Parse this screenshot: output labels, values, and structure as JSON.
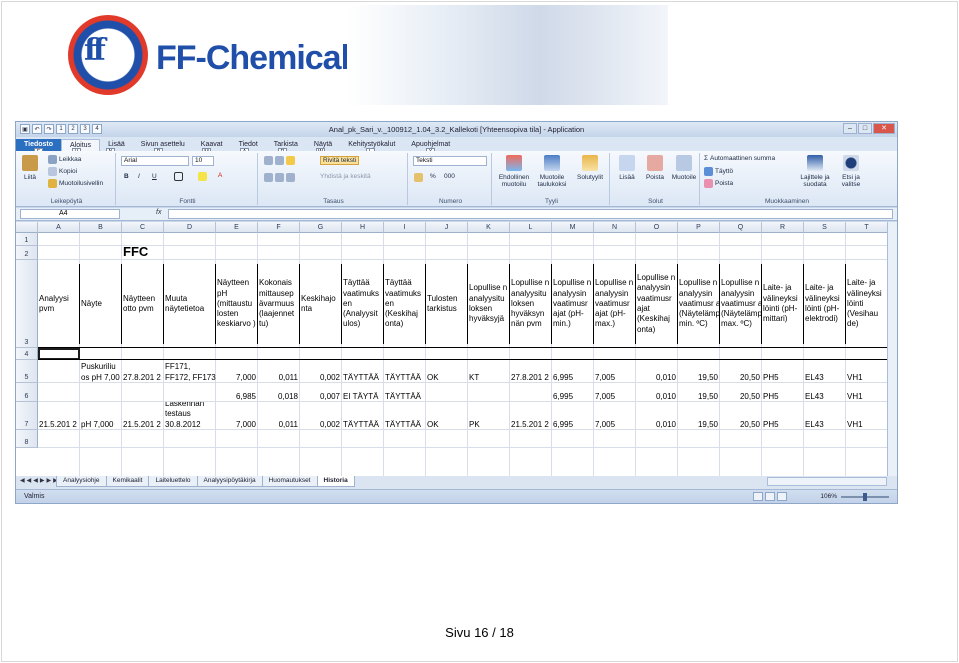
{
  "brand": {
    "logo_name": "FF-Chemicals"
  },
  "window": {
    "title": "Anal_pk_Sari_v._100912_1.04_3.2_Kallekoti [Yhteensopiva tila] - Application",
    "qat_keytips": [
      "1",
      "2",
      "3",
      "4"
    ]
  },
  "tabs": [
    "Tiedosto",
    "Aloitus",
    "Lisää",
    "Sivun asettelu",
    "Kaavat",
    "Tiedot",
    "Tarkista",
    "Näytä",
    "Kehitystyökalut",
    "Apuohjelmat"
  ],
  "keytips": [
    "F",
    "H",
    "N",
    "P",
    "M",
    "A",
    "R",
    "W",
    "L",
    "X"
  ],
  "ribbon": {
    "clipboard": {
      "label": "Leikepöytä",
      "paste": "Liitä",
      "cut": "Leikkaa",
      "copy": "Kopioi",
      "format_painter": "Muotoilusivellin"
    },
    "font": {
      "label": "Fontti",
      "font_name": "Arial",
      "font_size": "10",
      "bold": "B",
      "italic": "I",
      "underline": "U"
    },
    "alignment": {
      "label": "Tasaus",
      "wrap": "Rivitä teksti",
      "merge": "Yhdistä ja keskitä"
    },
    "number": {
      "label": "Numero",
      "format": "Teksti",
      "percent": "%",
      "thousands": "000"
    },
    "styles": {
      "label": "Tyyli",
      "conditional": "Ehdollinen muotoilu",
      "table": "Muotoile taulukoksi",
      "cell": "Solutyylit"
    },
    "cells": {
      "label": "Solut",
      "insert": "Lisää",
      "delete": "Poista",
      "format": "Muotoile"
    },
    "editing": {
      "label": "Muokkaaminen",
      "autosum": "Automaattinen summa",
      "fill": "Täyttö",
      "clear": "Poista",
      "sort": "Lajittele ja suodata",
      "find": "Etsi ja valitse"
    }
  },
  "formula_bar": {
    "name_box": "A4",
    "fx": "fx",
    "value": ""
  },
  "columns": [
    "A",
    "B",
    "C",
    "D",
    "E",
    "F",
    "G",
    "H",
    "I",
    "J",
    "K",
    "L",
    "M",
    "N",
    "O",
    "P",
    "Q",
    "R",
    "S",
    "T"
  ],
  "rows": [
    "1",
    "2",
    "3",
    "4",
    "5",
    "6",
    "7",
    "8"
  ],
  "sheet": {
    "title": "FFC",
    "headers": [
      "Analyysi pvm",
      "Näyte",
      "Näytteen otto pvm",
      "Muuta näytetietoa",
      "Näytteen pH (mittaustu losten keskiarvo )",
      "Kokonais mittausep ävarmuus (laajennet tu)",
      "Keskihajo nta",
      "Täyttää vaatimuks en (Analyysit ulos)",
      "Täyttää vaatimuks en (Keskihaj onta)",
      "Tulosten tarkistus",
      "Lopullise n analyysitu loksen hyväksyjä",
      "Lopullise n analyysitu loksen hyväksyn nän pvm",
      "Lopullise n analyysin vaatimusr ajat (pH-min.)",
      "Lopullise n analyysin vaatimusr ajat (pH-max.)",
      "Lopullise n analyysin vaatimusr ajat (Keskihaj onta)",
      "Lopullise n analyysin vaatimusr ajat (Näytelämpötila min. ºC)",
      "Lopullise n analyysin vaatimusr ajat (Näytelämpötila max. ºC)",
      "Laite- ja välineyksi löinti (pH-mittari)",
      "Laite- ja välineyksi löinti (pH-elektrodi)",
      "Laite- ja välineyksi löinti (Vesihau de)",
      "La va lö (L tä"
    ],
    "data_rows": [
      {
        "A": "",
        "B": "Puskuriliu os pH 7,00",
        "C": "27.8.201 2",
        "D": "FF171, FF172, FF173",
        "E": "7,000",
        "F": "0,011",
        "G": "0,002",
        "H": "TÄYTTÄÄ",
        "I": "TÄYTTÄÄ",
        "J": "OK",
        "K": "KT",
        "L": "27.8.201 2",
        "M": "6,995",
        "N": "7,005",
        "O": "0,010",
        "P": "19,50",
        "Q": "20,50",
        "R": "PH5",
        "S": "EL43",
        "T": "VH1",
        "U": "LI C"
      },
      {
        "A": "",
        "B": "",
        "C": "",
        "D": "",
        "E": "6,985",
        "F": "0,018",
        "G": "0,007",
        "H": "EI TÄYTÄ",
        "I": "TÄYTTÄÄ",
        "J": "",
        "K": "",
        "L": "",
        "M": "6,995",
        "N": "7,005",
        "O": "0,010",
        "P": "19,50",
        "Q": "20,50",
        "R": "PH5",
        "S": "EL43",
        "T": "VH1",
        "U": "LI C"
      },
      {
        "A": "21.5.201 2",
        "B": "pH 7,000",
        "C": "21.5.201 2",
        "D": "Laskennan testaus 30.8.2012",
        "E": "7,000",
        "F": "0,011",
        "G": "0,002",
        "H": "TÄYTTÄÄ",
        "I": "TÄYTTÄÄ",
        "J": "OK",
        "K": "PK",
        "L": "21.5.201 2",
        "M": "6,995",
        "N": "7,005",
        "O": "0,010",
        "P": "19,50",
        "Q": "20,50",
        "R": "PH5",
        "S": "EL43",
        "T": "VH1",
        "U": "LI C"
      }
    ]
  },
  "sheet_tabs": [
    "Analyysiohje",
    "Kemikaalit",
    "Laiteluettelo",
    "Analyysipöytäkirja",
    "Huomautukset",
    "Historia"
  ],
  "status": {
    "ready": "Valmis",
    "zoom": "106%"
  },
  "footer": {
    "page": "Sivu 16 / 18"
  }
}
